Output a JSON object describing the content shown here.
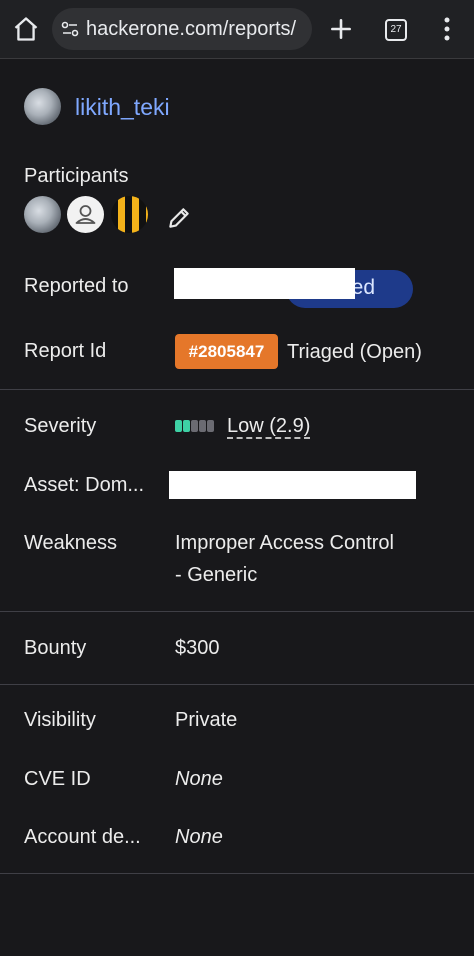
{
  "browser": {
    "url": "hackerone.com/reports/",
    "tab_count": "27",
    "icons": [
      "home-icon",
      "site-info-icon",
      "plus-icon",
      "tab-switcher-icon",
      "kebab-menu-icon"
    ]
  },
  "reporter": {
    "name": "likith_teki"
  },
  "participants": {
    "label": "Participants"
  },
  "reported_to": {
    "label": "Reported to",
    "status_partial": "ged"
  },
  "report_id": {
    "label": "Report Id",
    "id": "#2805847",
    "state": "Triaged (Open)"
  },
  "severity": {
    "label": "Severity",
    "value": "Low (2.9)",
    "level_filled": 2,
    "level_total": 5,
    "accent": "#3ed1a5"
  },
  "asset": {
    "label": "Asset: Dom..."
  },
  "weakness": {
    "label": "Weakness",
    "line1": "Improper Access Control",
    "line2": "- Generic"
  },
  "bounty": {
    "label": "Bounty",
    "value": "$300"
  },
  "visibility": {
    "label": "Visibility",
    "value": "Private"
  },
  "cve": {
    "label": "CVE ID",
    "value": "None"
  },
  "account": {
    "label": "Account de...",
    "value": "None"
  },
  "colors": {
    "link": "#7fa8ff",
    "badge": "#e5772a",
    "pill": "#1e3a8a",
    "background": "#18181b"
  }
}
